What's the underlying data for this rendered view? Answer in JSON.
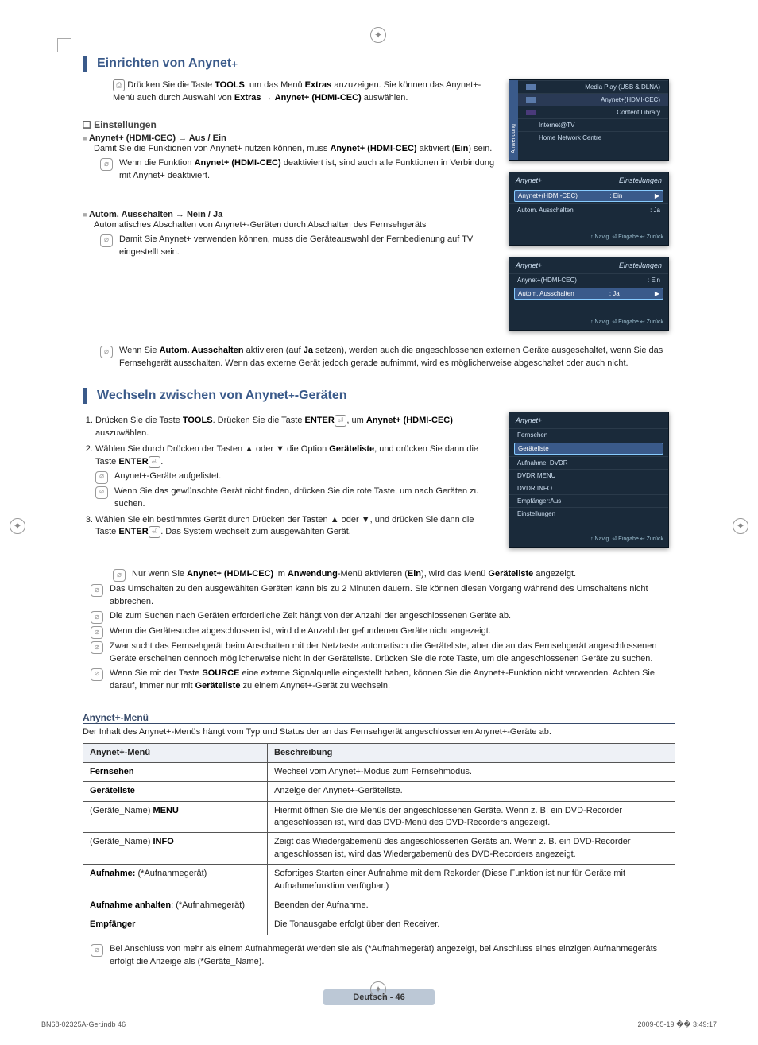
{
  "sec1": {
    "title_pre": "Einrichten von Anynet",
    "title_sup": "+",
    "p1_pre": "Drücken Sie die Taste ",
    "p1_b1": "TOOLS",
    "p1_mid": ", um das Menü ",
    "p1_b2": "Extras",
    "p1_end": " anzuzeigen. Sie können das Anynet+-Menü auch durch Auswahl von ",
    "p1_b3": "Extras",
    "p1_arrow": " → ",
    "p1_b4": "Anynet+ (HDMI-CEC)",
    "p1_tail": " auswählen."
  },
  "settings": {
    "q": "Einstellungen",
    "i1": "Anynet+ (HDMI-CEC) → Aus / Ein",
    "i1t_pre": "Damit Sie die Funktionen von Anynet+ nutzen können, muss ",
    "i1t_b": "Anynet+ (HDMI-CEC)",
    "i1t_mid": " aktiviert (",
    "i1t_ein": "Ein",
    "i1t_end": ") sein.",
    "i1n_pre": "Wenn die Funktion ",
    "i1n_b": "Anynet+ (HDMI-CEC)",
    "i1n_end": " deaktiviert ist, sind auch alle Funktionen in Verbindung mit Anynet+ deaktiviert.",
    "i2": "Autom. Ausschalten → Nein / Ja",
    "i2t": "Automatisches Abschalten von Anynet+-Geräten durch Abschalten des Fernsehgeräts",
    "i2n1": "Damit Sie Anynet+ verwenden können, muss die Geräteauswahl der Fernbedienung auf TV eingestellt sein.",
    "i2n2_pre": "Wenn Sie ",
    "i2n2_b1": "Autom. Ausschalten",
    "i2n2_mid": " aktivieren (auf ",
    "i2n2_b2": "Ja",
    "i2n2_end": " setzen), werden auch die angeschlossenen externen Geräte ausgeschaltet, wenn Sie das Fernsehgerät ausschalten. Wenn das externe Gerät jedoch gerade aufnimmt, wird es möglicherweise abgeschaltet oder auch nicht."
  },
  "shot1": {
    "tab": "Anwendung",
    "r1": "Media Play (USB & DLNA)",
    "r2": "Anynet+(HDMI-CEC)",
    "r3": "Content Library",
    "r4": "Internet@TV",
    "r5": "Home Network Centre"
  },
  "shot2": {
    "brand": "Anynet+",
    "title": "Einstellungen",
    "r1l": "Anynet+(HDMI-CEC)",
    "r1v": ": Ein",
    "r2l": "Autom. Ausschalten",
    "r2v": ": Ja",
    "ftr": "↕ Navig.   ⏎ Eingabe   ↩ Zurück"
  },
  "sec2": {
    "title_pre": "Wechseln zwischen von Anynet",
    "title_sup": "+",
    "title_post": "-Geräten",
    "s1_pre": "Drücken Sie die Taste ",
    "s1_b1": "TOOLS",
    "s1_mid": ". Drücken Sie die Taste ",
    "s1_b2": "ENTER",
    "s1_mid2": ", um ",
    "s1_b3": "Anynet+ (HDMI-CEC)",
    "s1_end": " auszuwählen.",
    "s2_pre": "Wählen Sie durch Drücken der Tasten ▲ oder ▼ die Option ",
    "s2_b": "Geräteliste",
    "s2_mid": ", und drücken Sie dann die Taste ",
    "s2_b2": "ENTER",
    "s2_dot": ".",
    "s2n1": "Anynet+-Geräte aufgelistet.",
    "s2n2": "Wenn Sie das gewünschte Gerät nicht finden, drücken Sie die rote Taste, um nach Geräten zu suchen.",
    "s3_pre": "Wählen Sie ein bestimmtes Gerät durch Drücken der Tasten ▲ oder ▼, und drücken Sie dann die Taste ",
    "s3_b": "ENTER",
    "s3_end": ". Das System wechselt zum ausgewählten Gerät.",
    "s3n_pre": "Nur wenn Sie ",
    "s3n_b1": "Anynet+ (HDMI-CEC)",
    "s3n_mid1": " im ",
    "s3n_b2": "Anwendung",
    "s3n_mid2": "-Menü aktivieren (",
    "s3n_b3": "Ein",
    "s3n_mid3": "), wird das Menü ",
    "s3n_b4": "Geräteliste",
    "s3n_end": " angezeigt.",
    "bn1": "Das Umschalten zu den ausgewählten Geräten kann bis zu 2 Minuten dauern. Sie können diesen Vorgang während des Umschaltens nicht abbrechen.",
    "bn2": "Die zum Suchen nach Geräten erforderliche Zeit hängt von der Anzahl der angeschlossenen Geräte ab.",
    "bn3": "Wenn die Gerätesuche abgeschlossen ist, wird die Anzahl der gefundenen Geräte nicht angezeigt.",
    "bn4": "Zwar sucht das Fernsehgerät beim Anschalten mit der Netztaste automatisch die Geräteliste, aber die an das Fernsehgerät angeschlossenen Geräte erscheinen dennoch möglicherweise nicht in der Geräteliste. Drücken Sie die rote Taste, um die angeschlossenen Geräte zu suchen.",
    "bn5_pre": "Wenn Sie mit der Taste ",
    "bn5_b1": "SOURCE",
    "bn5_mid": " eine externe Signalquelle eingestellt haben, können Sie die Anynet+-Funktion nicht verwenden. Achten Sie darauf, immer nur mit ",
    "bn5_b2": "Geräteliste",
    "bn5_end": " zu einem Anynet+-Gerät zu wechseln."
  },
  "shot3": {
    "brand": "Anynet+",
    "r1": "Fernsehen",
    "r2": "Geräteliste",
    "r3": "Aufnahme: DVDR",
    "r4": "DVDR MENU",
    "r5": "DVDR INFO",
    "r6": "Empfänger:Aus",
    "r7": "Einstellungen",
    "ftr": "↕ Navig.   ⏎ Eingabe   ↩ Zurück"
  },
  "menu": {
    "h": "Anynet+-Menü",
    "desc": "Der Inhalt des Anynet+-Menüs hängt vom Typ und Status der an das Fernsehgerät angeschlossenen Anynet+-Geräte ab.",
    "th1": "Anynet+-Menü",
    "th2": "Beschreibung",
    "rows": [
      {
        "c1_pre": "",
        "c1_b": "Fernsehen",
        "c1_post": "",
        "c2": "Wechsel vom Anynet+-Modus zum Fernsehmodus."
      },
      {
        "c1_pre": "",
        "c1_b": "Geräteliste",
        "c1_post": "",
        "c2": "Anzeige der Anynet+-Geräteliste."
      },
      {
        "c1_pre": "(Geräte_Name) ",
        "c1_b": "MENU",
        "c1_post": "",
        "c2": "Hiermit öffnen Sie die Menüs der angeschlossenen Geräte. Wenn z. B. ein DVD-Recorder angeschlossen ist, wird das DVD-Menü des DVD-Recorders angezeigt."
      },
      {
        "c1_pre": "(Geräte_Name) ",
        "c1_b": "INFO",
        "c1_post": "",
        "c2": "Zeigt das Wiedergabemenü des angeschlossenen Geräts an. Wenn z. B. ein DVD-Recorder angeschlossen ist, wird das Wiedergabemenü des DVD-Recorders angezeigt."
      },
      {
        "c1_pre": "",
        "c1_b": "Aufnahme:",
        "c1_post": " (*Aufnahmegerät)",
        "c2": "Sofortiges Starten einer Aufnahme mit dem Rekorder (Diese Funktion ist nur für Geräte mit Aufnahmefunktion verfügbar.)"
      },
      {
        "c1_pre": "",
        "c1_b": "Aufnahme anhalten",
        "c1_post": ": (*Aufnahmegerät)",
        "c2": "Beenden der Aufnahme."
      },
      {
        "c1_pre": "",
        "c1_b": "Empfänger",
        "c1_post": "",
        "c2": "Die Tonausgabe erfolgt über den Receiver."
      }
    ],
    "foot": "Bei Anschluss von mehr als einem Aufnahmegerät werden sie als (*Aufnahmegerät) angezeigt, bei Anschluss eines einzigen Aufnahmegeräts erfolgt die Anzeige als (*Geräte_Name)."
  },
  "pagelabel": "Deutsch - 46",
  "footer": {
    "l": "BN68-02325A-Ger.indb   46",
    "r": "2009-05-19   �� 3:49:17"
  }
}
